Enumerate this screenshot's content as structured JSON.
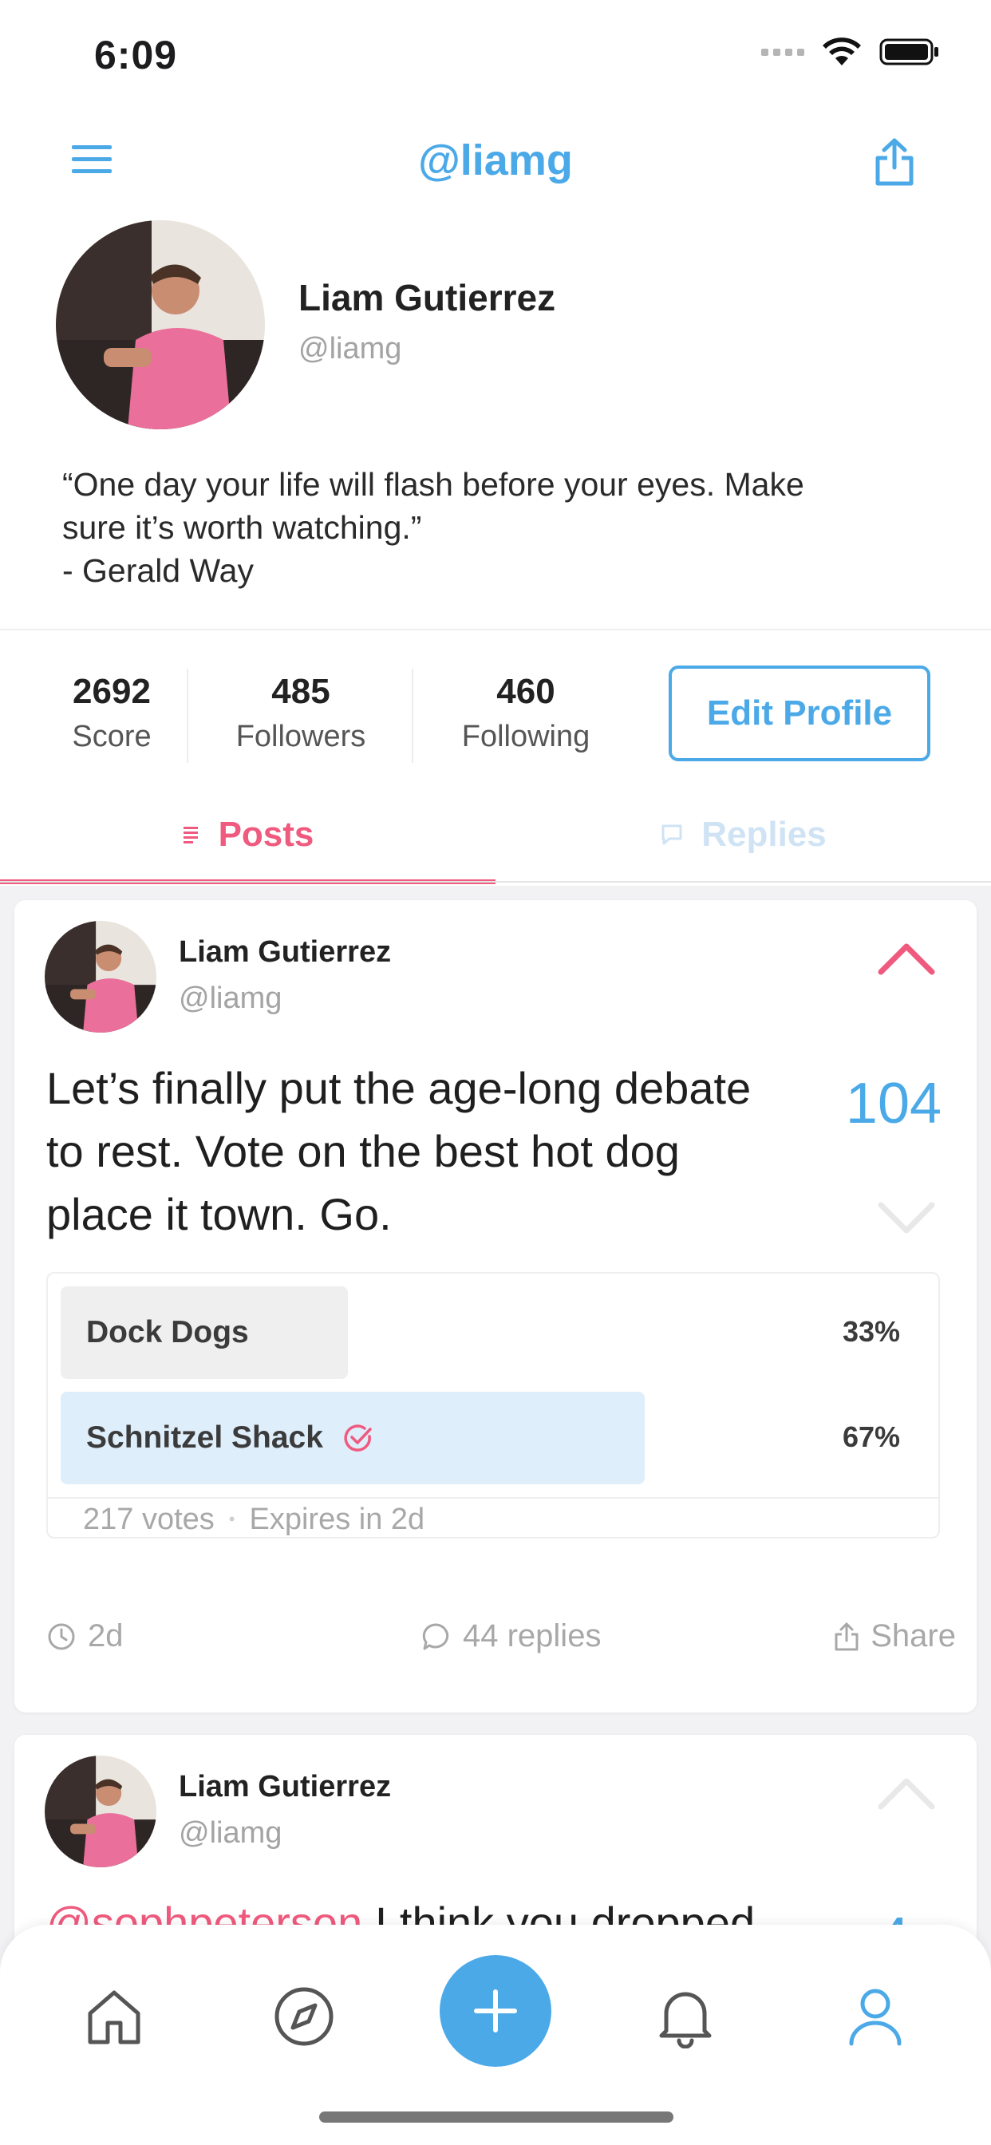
{
  "status_bar": {
    "time": "6:09"
  },
  "nav": {
    "title": "@liamg"
  },
  "profile": {
    "name": "Liam Gutierrez",
    "handle": "@liamg",
    "bio_lines": [
      "“One day your life will flash before your eyes. Make",
      "sure it’s worth watching.”",
      "- Gerald Way"
    ]
  },
  "stats": [
    {
      "value": "2692",
      "label": "Score"
    },
    {
      "value": "485",
      "label": "Followers"
    },
    {
      "value": "460",
      "label": "Following"
    }
  ],
  "edit_profile_label": "Edit Profile",
  "tabs": [
    {
      "label": "Posts",
      "active": true
    },
    {
      "label": "Replies",
      "active": false
    }
  ],
  "posts": [
    {
      "author": "Liam Gutierrez",
      "handle": "@liamg",
      "text_lines": [
        "Let’s finally put the age-long debate",
        "to rest. Vote on the best hot dog",
        "place it town. Go."
      ],
      "votes": "104",
      "poll": {
        "options": [
          {
            "label": "Dock Dogs",
            "percent": "33%",
            "selected": false
          },
          {
            "label": "Schnitzel Shack",
            "percent": "67%",
            "selected": true
          }
        ],
        "votes_text": "217 votes",
        "separator": "•",
        "expires_text": "Expires in 2d"
      },
      "time": "2d",
      "replies": "44 replies",
      "share": "Share"
    },
    {
      "author": "Liam Gutierrez",
      "handle": "@liamg",
      "mention": "@sophpeterson",
      "text_after_mention": " I think you dropped",
      "votes": "4"
    }
  ],
  "colors": {
    "accent_blue": "#4ba9e8",
    "accent_pink": "#ef5a7e",
    "feed_background": "#f2f2f4"
  },
  "icons": {
    "menu": "menu-icon",
    "share": "share-icon",
    "posts_tab": "list-icon",
    "replies_tab": "comment-icon",
    "upvote": "chevron-up-icon",
    "downvote": "chevron-down-icon",
    "check": "check-circle-icon",
    "clock": "clock-icon",
    "reply": "comment-icon",
    "tab_home": "home-icon",
    "tab_explore": "compass-icon",
    "tab_add": "plus-icon",
    "tab_notifications": "bell-icon",
    "tab_profile": "user-icon"
  }
}
